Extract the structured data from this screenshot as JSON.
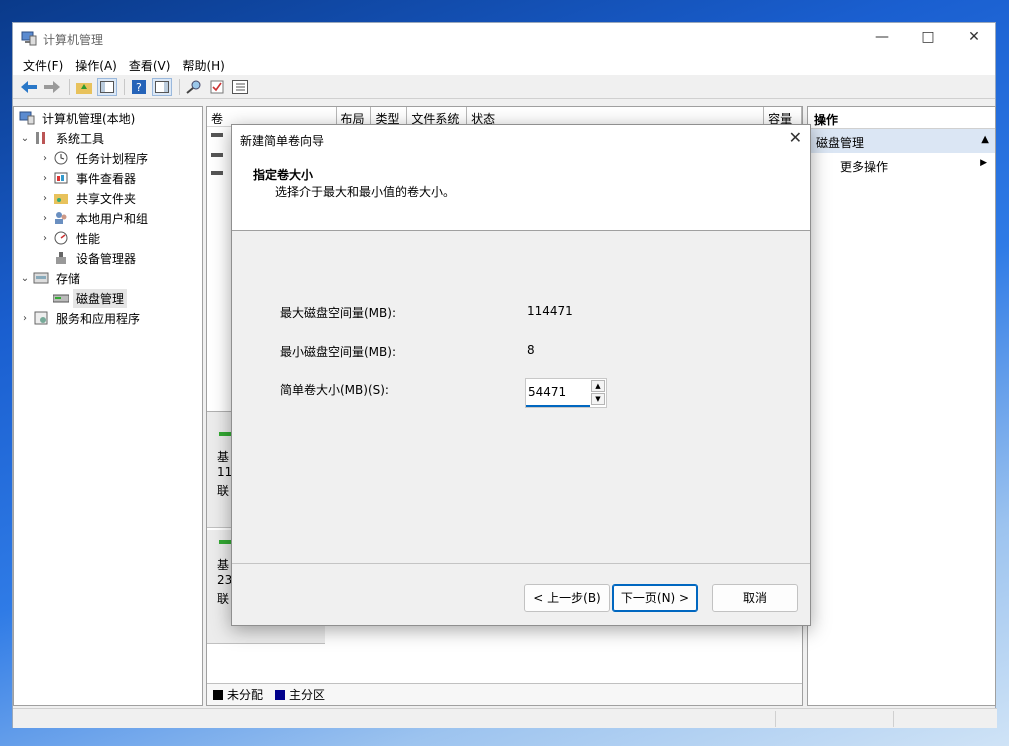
{
  "app": {
    "title": "计算机管理",
    "menu": [
      "文件(F)",
      "操作(A)",
      "查看(V)",
      "帮助(H)"
    ]
  },
  "tree": {
    "root": "计算机管理(本地)",
    "system_tools": "系统工具",
    "items": [
      "任务计划程序",
      "事件查看器",
      "共享文件夹",
      "本地用户和组",
      "性能",
      "设备管理器"
    ],
    "storage": "存储",
    "disk_mgmt": "磁盘管理",
    "services": "服务和应用程序"
  },
  "volume_table": {
    "columns": [
      "卷",
      "布局",
      "类型",
      "文件系统",
      "状态",
      "容量"
    ]
  },
  "disk_rows": [
    {
      "l1": "基",
      "l2": "11",
      "l3": "联"
    },
    {
      "l1": "基",
      "l2": "23",
      "l3": "联"
    }
  ],
  "legend": {
    "unallocated": "未分配",
    "primary": "主分区",
    "unallocated_color": "#000000",
    "primary_color": "#00008b"
  },
  "actions": {
    "header": "操作",
    "section": "磁盘管理",
    "more": "更多操作"
  },
  "dialog": {
    "title": "新建简单卷向导",
    "heading": "指定卷大小",
    "subheading": "选择介于最大和最小值的卷大小。",
    "max_label": "最大磁盘空间量(MB):",
    "max_value": "114471",
    "min_label": "最小磁盘空间量(MB):",
    "min_value": "8",
    "size_label": "简单卷大小(MB)(S):",
    "size_value": "54471",
    "back_button": "< 上一步(B)",
    "next_button": "下一页(N) >",
    "cancel_button": "取消"
  },
  "colors": {
    "accent": "#0067c0",
    "action_section_bg": "#dbe6f4"
  }
}
